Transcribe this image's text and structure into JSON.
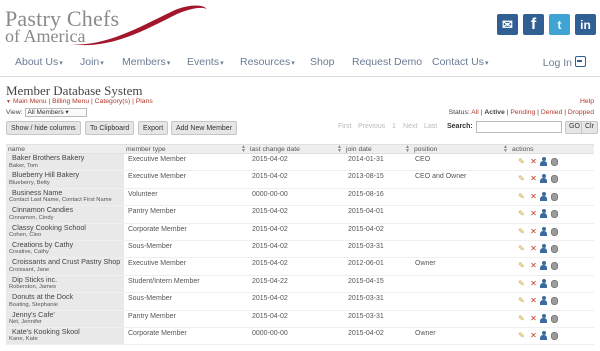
{
  "brand": {
    "line1": "Pastry Chefs",
    "line2": "of America"
  },
  "social": [
    {
      "name": "email",
      "glyph": "✉"
    },
    {
      "name": "facebook",
      "glyph": "f"
    },
    {
      "name": "twitter",
      "glyph": "t"
    },
    {
      "name": "linkedin",
      "glyph": "in"
    }
  ],
  "nav": {
    "items": [
      {
        "label": "About Us",
        "dropdown": true
      },
      {
        "label": "Join",
        "dropdown": true
      },
      {
        "label": "Members",
        "dropdown": true
      },
      {
        "label": "Events",
        "dropdown": true
      },
      {
        "label": "Resources",
        "dropdown": true
      },
      {
        "label": "Shop",
        "dropdown": false
      },
      {
        "label": "Request Demo",
        "dropdown": false
      },
      {
        "label": "Contact Us",
        "dropdown": true
      }
    ],
    "login": "Log In"
  },
  "page": {
    "title": "Member Database System",
    "submenu": "Main Menu | Billing Menu | Category(s) | Plans",
    "help": "Help",
    "view_label": "View:",
    "view_value": "All Members",
    "status_label": "Status:",
    "status_all": "All",
    "status_active": "Active",
    "status_pending": "Pending",
    "status_denied": "Denied",
    "status_dropped": "Dropped"
  },
  "toolbar": {
    "show_hide": "Show / hide columns",
    "to_clipboard": "To Clipboard",
    "export": "Export",
    "add_new": "Add New Member",
    "first": "First",
    "previous": "Previous",
    "page": "1",
    "next": "Next",
    "last": "Last",
    "search_label": "Search:",
    "go": "GO",
    "clr": "Clr"
  },
  "table": {
    "columns": [
      "name",
      "member type",
      "last change date",
      "join date",
      "position",
      "actions"
    ],
    "rows": [
      {
        "name": "Baker Brothers Bakery",
        "sub": "Baker, Tom",
        "type": "Executive Member",
        "changed": "2015-04-02",
        "joined": "2014-01-31",
        "position": "CEO"
      },
      {
        "name": "Blueberry Hill Bakery",
        "sub": "Blueberry, Betty",
        "type": "Executive Member",
        "changed": "2015-04-02",
        "joined": "2013-08-15",
        "position": "CEO and Owner"
      },
      {
        "name": "Business Name",
        "sub": "Contact Last Name, Contact First Name",
        "type": "Volunteer",
        "changed": "0000-00-00",
        "joined": "2015-08-16",
        "position": ""
      },
      {
        "name": "Cinnamon Candies",
        "sub": "Cinnamon, Cindy",
        "type": "Pantry Member",
        "changed": "2015-04-02",
        "joined": "2015-04-01",
        "position": ""
      },
      {
        "name": "Classy Cooking School",
        "sub": "Cohen, Cleo",
        "type": "Corporate Member",
        "changed": "2015-04-02",
        "joined": "2015-04-02",
        "position": ""
      },
      {
        "name": "Creations by Cathy",
        "sub": "Creative, Cathy",
        "type": "Sous-Member",
        "changed": "2015-04-02",
        "joined": "2015-03-31",
        "position": ""
      },
      {
        "name": "Croissants and Crust Pastry Shop",
        "sub": "Croissant, Jane",
        "type": "Executive Member",
        "changed": "2015-04-02",
        "joined": "2012-06-01",
        "position": "Owner"
      },
      {
        "name": "Dip Sticks inc.",
        "sub": "Roberston, James",
        "type": "Student/Intern Member",
        "changed": "2015-04-22",
        "joined": "2015-04-15",
        "position": ""
      },
      {
        "name": "Donuts at the Dock",
        "sub": "Boating, Stephanie",
        "type": "Sous-Member",
        "changed": "2015-04-02",
        "joined": "2015-03-31",
        "position": ""
      },
      {
        "name": "Jenny's Cafe'",
        "sub": "Net, Jennifer",
        "type": "Pantry Member",
        "changed": "2015-04-02",
        "joined": "2015-03-31",
        "position": ""
      },
      {
        "name": "Kate's Kooking Skool",
        "sub": "Kane, Kate",
        "type": "Corporate Member",
        "changed": "0000-00-00",
        "joined": "2015-04-02",
        "position": "Owner"
      }
    ]
  },
  "colors": {
    "accent_red": "#b03a2e",
    "nav_text": "#6a7c93",
    "brand_blue": "#2f5f93"
  }
}
